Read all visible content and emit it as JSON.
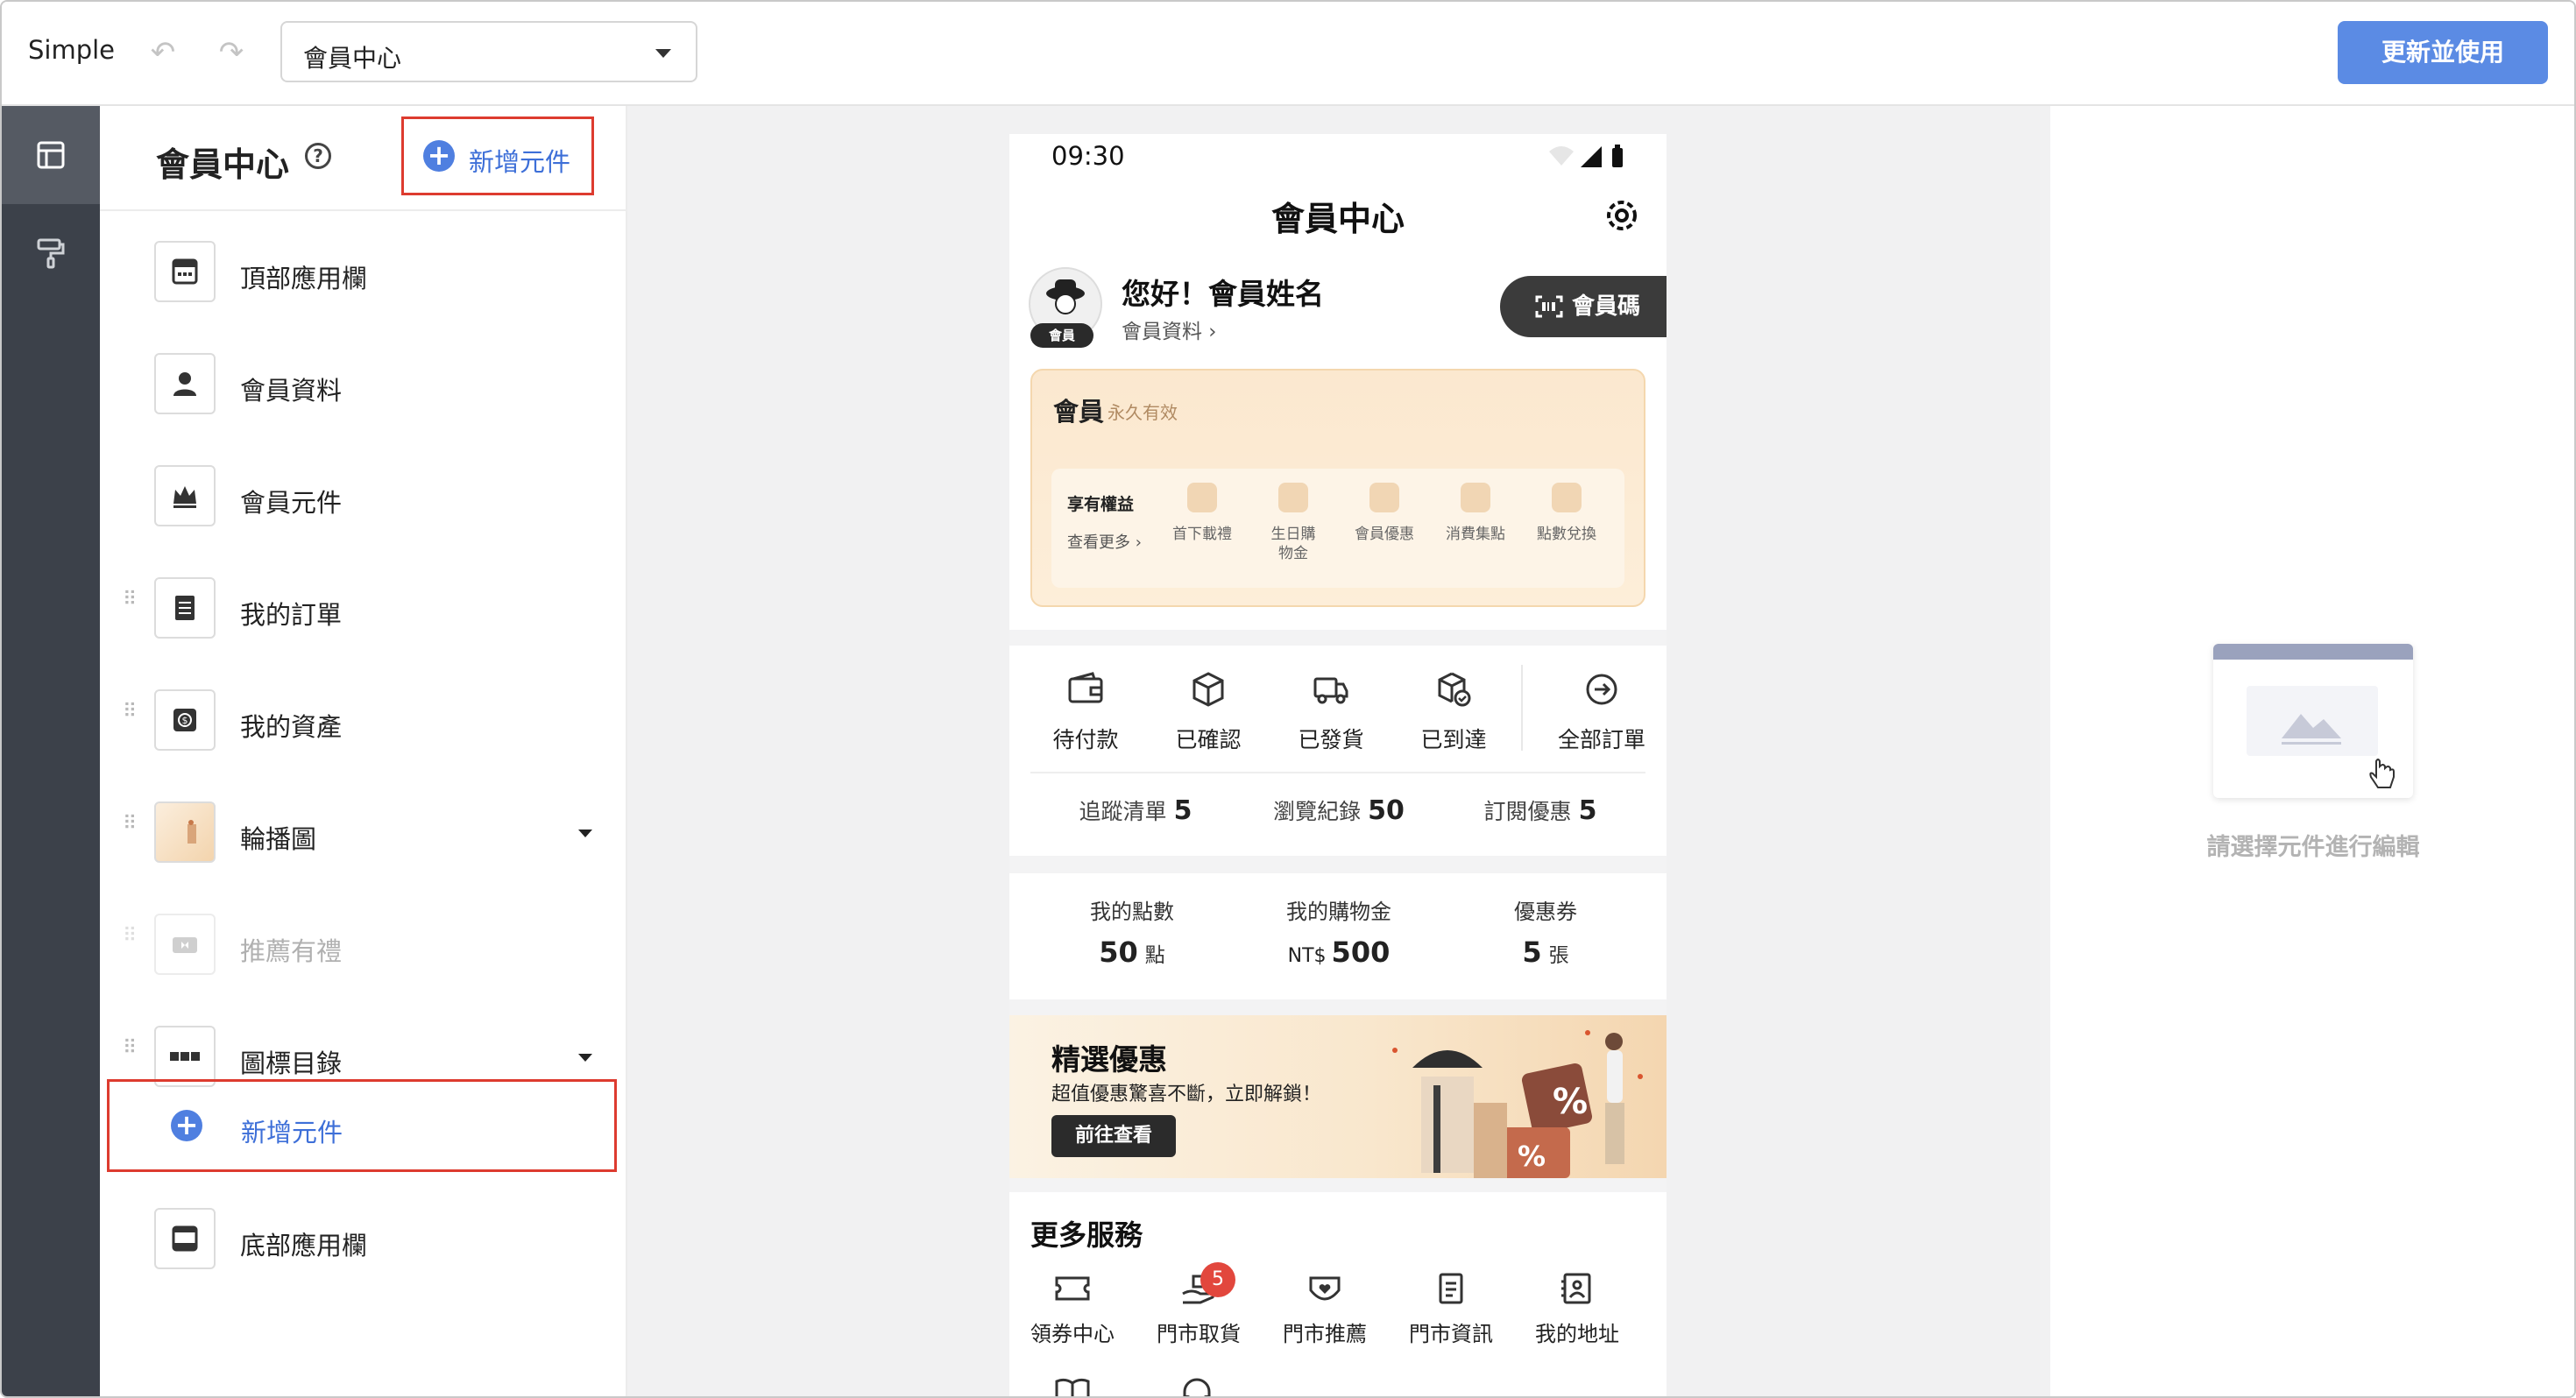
{
  "topbar": {
    "app_name": "Simple",
    "page_select_value": "會員中心",
    "update_button": "更新並使用"
  },
  "rail": {
    "items": [
      "layout-icon",
      "paint-roller-icon"
    ]
  },
  "panel": {
    "title": "會員中心",
    "add_component_label": "新增元件",
    "items": [
      {
        "label": "頂部應用欄",
        "icon": "top-bar-icon"
      },
      {
        "label": "會員資料",
        "icon": "person-icon"
      },
      {
        "label": "會員元件",
        "icon": "crown-icon"
      },
      {
        "label": "我的訂單",
        "icon": "order-list-icon"
      },
      {
        "label": "我的資產",
        "icon": "money-icon"
      },
      {
        "label": "輪播圖",
        "icon": "carousel-thumbnail"
      },
      {
        "label": "推薦有禮",
        "icon": "gift-icon"
      },
      {
        "label": "圖標目錄",
        "icon": "icon-grid-icon"
      },
      {
        "label": "底部應用欄",
        "icon": "bottom-bar-icon"
      }
    ],
    "add_row_label": "新增元件"
  },
  "phone": {
    "status_time": "09:30",
    "title": "會員中心",
    "avatar_badge": "會員",
    "greeting": "您好！會員姓名",
    "profile_link": "會員資料 ›",
    "member_code_button": "會員碼",
    "card": {
      "title": "會員",
      "validity": "永久有效",
      "perks_heading": "享有權益",
      "perks_more": "查看更多 ›",
      "perks": [
        "首下載禮",
        "生日購物金",
        "會員優惠",
        "消費集點",
        "點數兌換"
      ]
    },
    "orders": [
      "待付款",
      "已確認",
      "已發貨",
      "已到達",
      "全部訂單"
    ],
    "stats": [
      {
        "label": "追蹤清單",
        "value": "5"
      },
      {
        "label": "瀏覽紀錄",
        "value": "50"
      },
      {
        "label": "訂閱優惠",
        "value": "5"
      }
    ],
    "assets": [
      {
        "label": "我的點數",
        "value": "50",
        "unit": "點",
        "prefix": ""
      },
      {
        "label": "我的購物金",
        "value": "500",
        "unit": "",
        "prefix": "NT$"
      },
      {
        "label": "優惠券",
        "value": "5",
        "unit": "張",
        "prefix": ""
      }
    ],
    "banner": {
      "title": "精選優惠",
      "subtitle": "超值優惠驚喜不斷，立即解鎖！",
      "button": "前往查看"
    },
    "services_title": "更多服務",
    "services": [
      "領券中心",
      "門市取貨",
      "門市推薦",
      "門市資訊",
      "我的地址"
    ],
    "services_badge": "5"
  },
  "right_panel": {
    "hint": "請選擇元件進行編輯"
  },
  "colors": {
    "accent": "#5b8be4",
    "highlight": "#dd3b2f",
    "rail": "#3c414a"
  }
}
